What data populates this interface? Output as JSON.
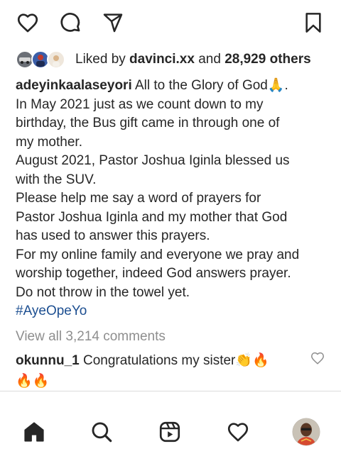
{
  "likes": {
    "prefix": "Liked by ",
    "user": "davinci.xx",
    "middle": " and ",
    "count": "28,929 others"
  },
  "caption": {
    "username": "adeyinkaalaseyori",
    "lines": [
      " All to the Glory of God",
      "In May 2021 just as we count down to my",
      "birthday, the Bus gift came in through one of",
      "my mother.",
      "August 2021, Pastor Joshua Iginla blessed us",
      "with the SUV.",
      "Please help me say a word of prayers for",
      "Pastor Joshua Iginla and my mother that God",
      "has used to answer this prayers.",
      "For my online family and everyone we pray and",
      "worship together, indeed God answers prayer.",
      "Do not throw in the towel yet."
    ],
    "first_line_emoji": "🙏",
    "first_line_end": ".",
    "hashtag": "#AyeOpeYo"
  },
  "view_all_comments": "View all 3,214 comments",
  "comment": {
    "username": "okunnu_1",
    "text": " Congratulations my sister",
    "emojis_line1": "👏🔥",
    "emojis_line2": "🔥🔥"
  },
  "icons": {
    "actions": [
      "heart-icon",
      "comment-icon",
      "share-icon",
      "bookmark-icon"
    ],
    "nav": [
      "home-icon",
      "search-icon",
      "reels-icon",
      "activity-heart-icon",
      "profile-avatar"
    ]
  },
  "colors": {
    "text": "#262626",
    "muted": "#8e8e8e",
    "hashtag": "#1d4f91",
    "divider": "#dbdbdb"
  }
}
